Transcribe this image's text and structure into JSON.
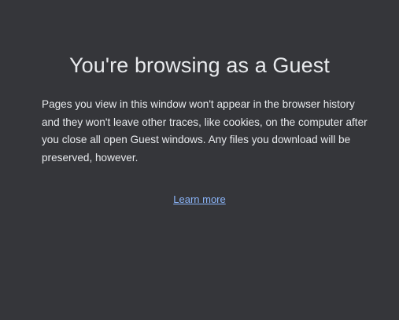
{
  "guest_page": {
    "title": "You're browsing as a Guest",
    "description": "Pages you view in this window won't appear in the browser history and they won't leave other traces, like cookies, on the computer after you close all open Guest windows. Any files you download will be preserved, however.",
    "learn_more_label": "Learn more"
  },
  "colors": {
    "background": "#35363a",
    "text": "#e8eaed",
    "link": "#8ab4f8"
  }
}
